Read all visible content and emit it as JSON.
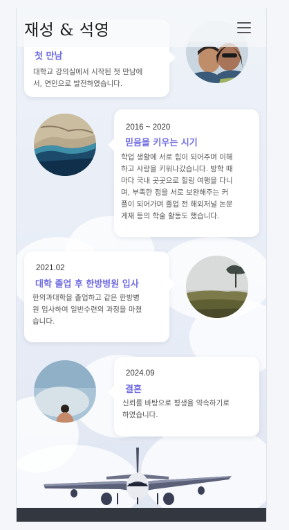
{
  "header": {
    "brand": "재성 & 석영",
    "menu_icon": "hamburger-menu-icon"
  },
  "timeline": [
    {
      "date": "",
      "title": "첫 만남",
      "lines": [
        "대학교 강의실에서 시작된 첫 만남에",
        "서, 연인으로 발전하였습니다."
      ]
    },
    {
      "date": "2016 ~ 2020",
      "title": "믿음을 키우는 시기",
      "lines": [
        "학업 생활에 서로 힘이 되어주며 이해",
        "하고 사랑을 키워나갔습니다. 방학 때",
        "마다 국내 곳곳으로 힐링 여행을 다니",
        "며, 부족한 점을 서로 보완해주는 커",
        "플이 되어가며 졸업 전 해외저널 논문",
        "게재 등의 학술 활동도 했습니다."
      ]
    },
    {
      "date": "2021.02",
      "title": "대학 졸업 후 한방병원 입사",
      "lines": [
        "한의과대학을 졸업하고 같은 한방병",
        "원 입사하여 일반수련의 과정을 마쳤",
        "습니다."
      ]
    },
    {
      "date": "2024.09",
      "title": "결혼",
      "lines": [
        "신뢰를 바탕으로 평생을 약속하기로",
        "하였습니다."
      ]
    }
  ],
  "photos": [
    "couple-selfie-photo",
    "coastal-aerial-photo",
    "misty-field-photo",
    "sky-back-view-photo"
  ],
  "illustration": "airplane-illustration",
  "colors": {
    "title": "#6f6be0",
    "footer": "#33373f",
    "text": "#555555"
  }
}
